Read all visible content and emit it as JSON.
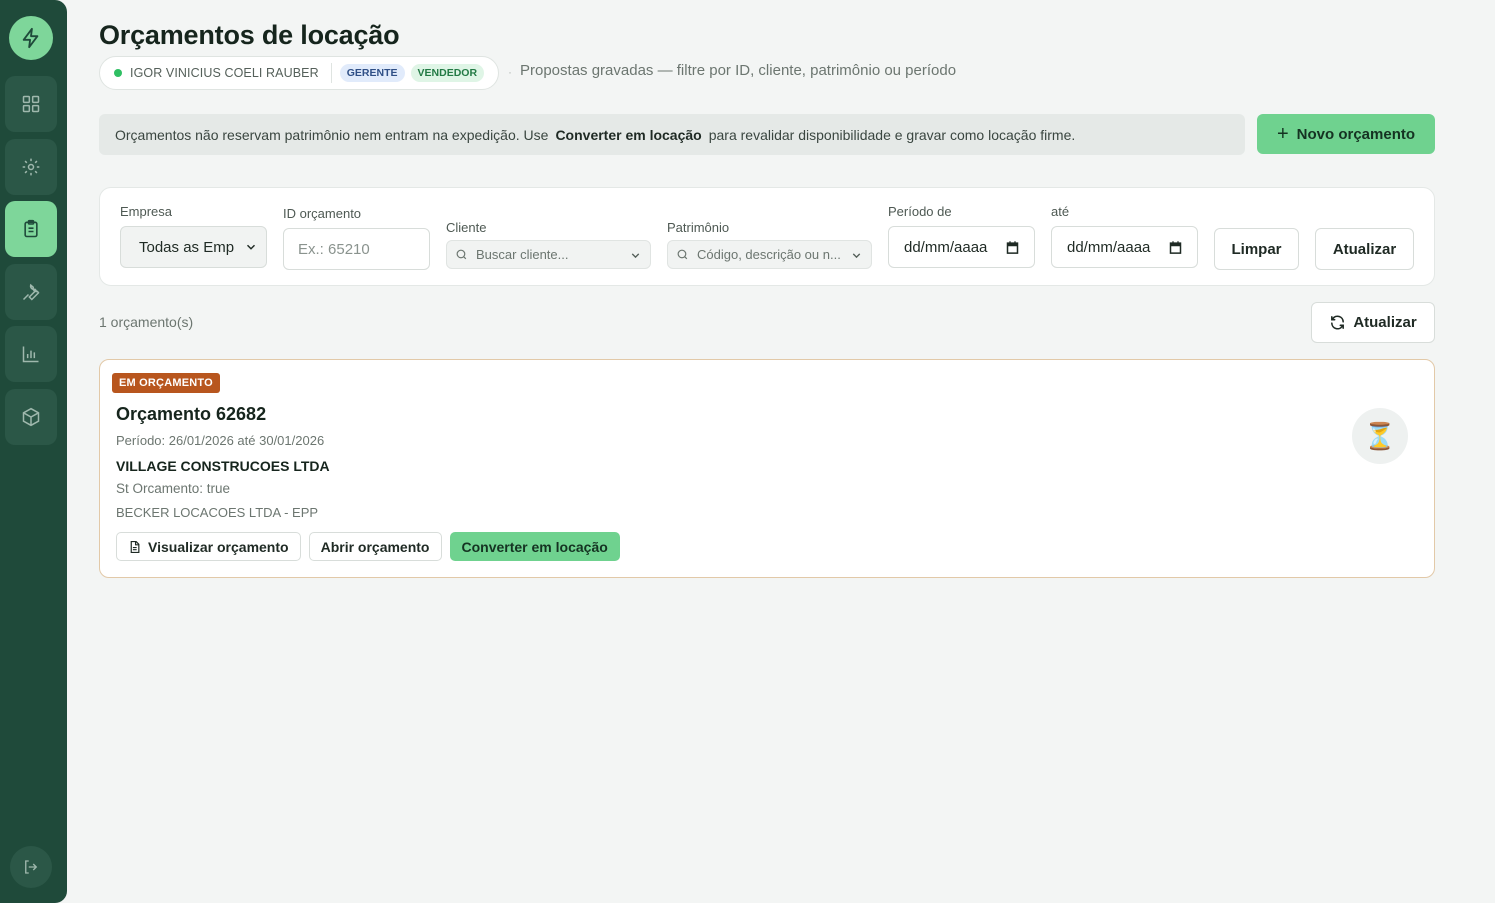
{
  "page": {
    "title": "Orçamentos de locação",
    "subtitle": "Propostas gravadas — filtre por ID, cliente, patrimônio ou período"
  },
  "user": {
    "name": "IGOR VINICIUS COELI RAUBER",
    "roles": [
      "GERENTE",
      "VENDEDOR"
    ]
  },
  "banner": {
    "before": "Orçamentos não reservam patrimônio nem entram na expedição. Use",
    "highlight": "Converter em locação",
    "after": "para revalidar disponibilidade e gravar como locação firme."
  },
  "new_button": "Novo orçamento",
  "filters": {
    "empresa": {
      "label": "Empresa",
      "value": "Todas as Emp"
    },
    "id": {
      "label": "ID orçamento",
      "placeholder": "Ex.: 65210"
    },
    "cliente": {
      "label": "Cliente",
      "placeholder": "Buscar cliente..."
    },
    "patrimonio": {
      "label": "Patrimônio",
      "placeholder": "Código, descrição ou n..."
    },
    "periodo_de": {
      "label": "Período de",
      "value": "dd/mm/aaaa"
    },
    "ate": {
      "label": "até",
      "value": "dd/mm/aaaa"
    },
    "clear": "Limpar",
    "refresh": "Atualizar"
  },
  "results": {
    "count": "1 orçamento(s)",
    "refresh": "Atualizar"
  },
  "quote": {
    "status": "EM ORÇAMENTO",
    "title": "Orçamento 62682",
    "period": "Período: 26/01/2026 até 30/01/2026",
    "client": "VILLAGE CONSTRUCOES LTDA",
    "st": "St Orcamento: true",
    "company": "BECKER LOCACOES LTDA - EPP",
    "actions": {
      "view": "Visualizar orçamento",
      "open": "Abrir orçamento",
      "convert": "Converter em locação"
    },
    "status_icon": "⏳"
  },
  "colors": {
    "sidebar": "#1f4a3a",
    "accent": "#6fd28f",
    "status_badge": "#b8561e"
  }
}
